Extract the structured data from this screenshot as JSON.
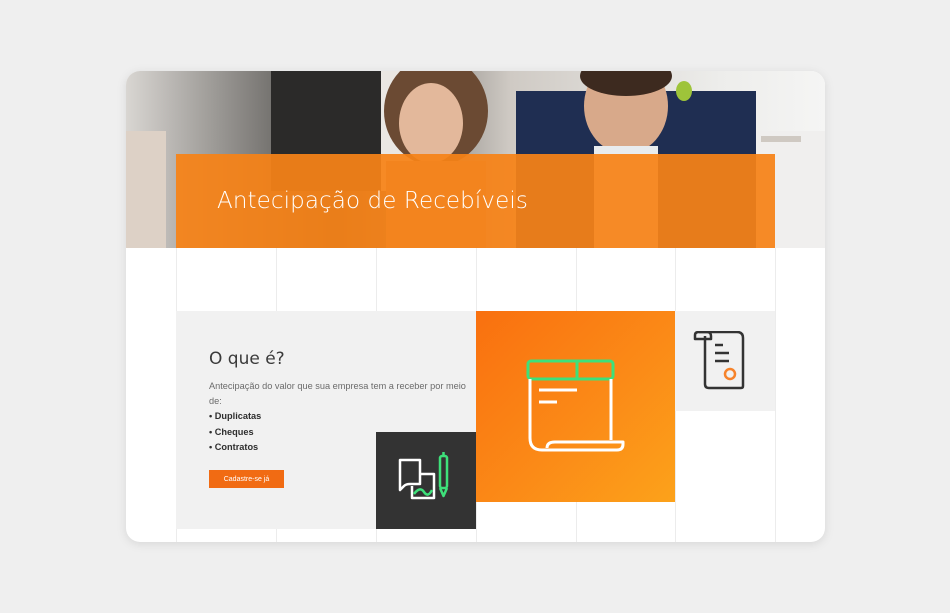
{
  "hero": {
    "title": "Antecipação de Recebíveis"
  },
  "about": {
    "heading": "O que é?",
    "description": "Antecipação do valor que sua empresa tem a receber por meio de:",
    "items": [
      "Duplicatas",
      "Cheques",
      "Contratos"
    ],
    "cta_label": "Cadastre-se já"
  },
  "icons": {
    "dark_tile": "contract-signing-icon",
    "orange_tile": "document-scroll-icon",
    "gray_tile": "certificate-icon"
  },
  "colors": {
    "accent": "#f16b13",
    "banner": "#f68217",
    "icon_green": "#3ee07a",
    "dark_tile": "#333333"
  }
}
